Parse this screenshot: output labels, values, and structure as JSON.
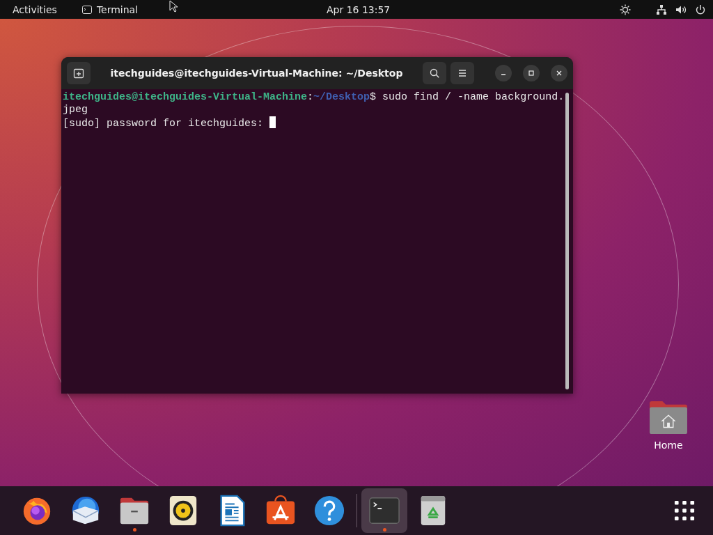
{
  "top_bar": {
    "activities": "Activities",
    "app_name": "Terminal",
    "clock": "Apr 16  13:57"
  },
  "window": {
    "title": "itechguides@itechguides-Virtual-Machine: ~/Desktop",
    "lines": [
      {
        "segments": [
          {
            "kind": "user",
            "text": "itechguides@itechguides-Virtual-Machine"
          },
          {
            "kind": "plain",
            "text": ":"
          },
          {
            "kind": "path",
            "text": "~/Desktop"
          },
          {
            "kind": "plain",
            "text": "$ sudo find / -name background.jpeg"
          }
        ]
      },
      {
        "segments": [
          {
            "kind": "plain",
            "text": "[sudo] password for itechguides: "
          },
          {
            "kind": "cursor"
          }
        ]
      }
    ]
  },
  "desktop_icons": [
    {
      "label": "Home"
    }
  ],
  "dock": {
    "groups": [
      {
        "items": [
          {
            "kind": "firefox",
            "running": false,
            "selected": false
          },
          {
            "kind": "mail",
            "running": false,
            "selected": false
          },
          {
            "kind": "files",
            "running": true,
            "selected": false
          },
          {
            "kind": "music",
            "running": false,
            "selected": false
          },
          {
            "kind": "writer",
            "running": false,
            "selected": false
          },
          {
            "kind": "store",
            "running": false,
            "selected": false
          },
          {
            "kind": "help",
            "running": false,
            "selected": false
          }
        ]
      },
      {
        "items": [
          {
            "kind": "terminal",
            "running": true,
            "selected": true
          },
          {
            "kind": "trash",
            "running": false,
            "selected": false
          }
        ]
      }
    ]
  }
}
